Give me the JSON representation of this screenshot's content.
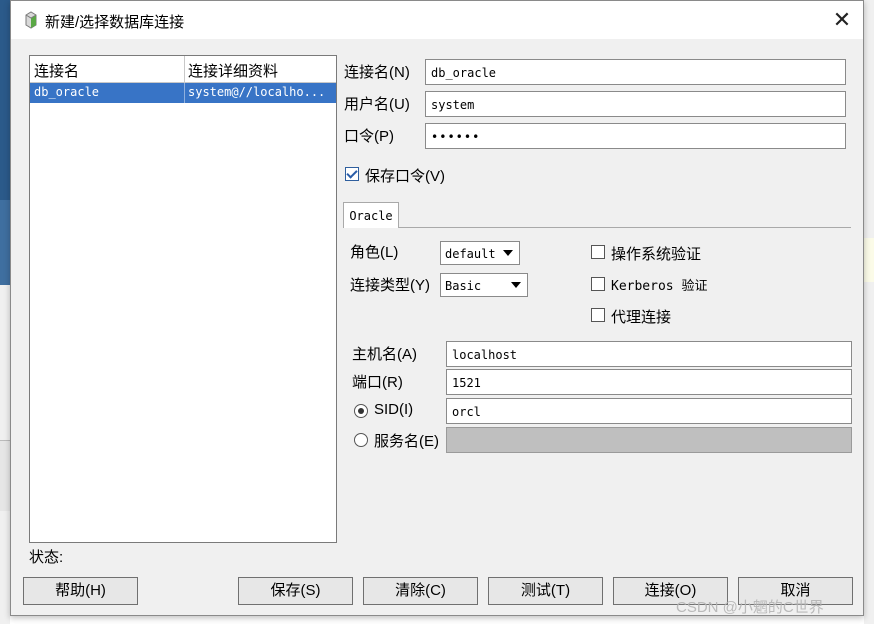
{
  "window": {
    "title": "新建/选择数据库连接",
    "close_glyph": "✕"
  },
  "list": {
    "col_name": "连接名",
    "col_details": "连接详细资料",
    "rows": [
      {
        "name": "db_oracle",
        "details": "system@//localho..."
      }
    ]
  },
  "form": {
    "conn_name_label": "连接名(N)",
    "conn_name_value": "db_oracle",
    "username_label": "用户名(U)",
    "username_value": "system",
    "password_label": "口令(P)",
    "password_value": "••••••",
    "save_password_label": "保存口令(V)",
    "save_password_checked": true
  },
  "tab": {
    "label": "Oracle"
  },
  "oracle": {
    "role_label": "角色(L)",
    "role_value": "default",
    "conn_type_label": "连接类型(Y)",
    "conn_type_value": "Basic",
    "os_auth_label": "操作系统验证",
    "kerberos_label": "Kerberos 验证",
    "proxy_label": "代理连接",
    "host_label": "主机名(A)",
    "host_value": "localhost",
    "port_label": "端口(R)",
    "port_value": "1521",
    "sid_label": "SID(I)",
    "sid_value": "orcl",
    "service_label": "服务名(E)",
    "service_value": ""
  },
  "status": {
    "label": "状态:"
  },
  "buttons": {
    "help": "帮助(H)",
    "save": "保存(S)",
    "clear": "清除(C)",
    "test": "测试(T)",
    "connect": "连接(O)",
    "cancel": "取消"
  },
  "watermark": "CSDN @小魍的C世界",
  "colors": {
    "selection": "#3874c6",
    "dialog_bg": "#f0f0f0",
    "disabled_field": "#bfbfbf"
  }
}
